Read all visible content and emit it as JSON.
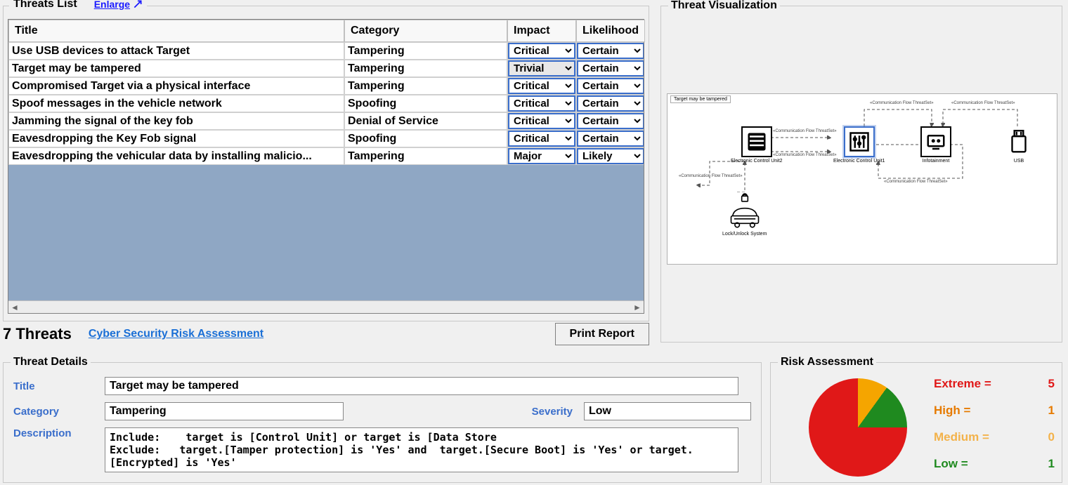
{
  "threats_list": {
    "label": "Threats List",
    "enlarge": "Enlarge",
    "columns": [
      "Title",
      "Category",
      "Impact",
      "Likelihood"
    ],
    "rows": [
      {
        "title": "Use USB devices to attack Target",
        "category": "Tampering",
        "impact": "Critical",
        "likelihood": "Certain"
      },
      {
        "title": "Target may be tampered",
        "category": "Tampering",
        "impact": "Trivial",
        "likelihood": "Certain",
        "impact_hl": true
      },
      {
        "title": "Compromised  Target via a physical interface",
        "category": "Tampering",
        "impact": "Critical",
        "likelihood": "Certain"
      },
      {
        "title": "Spoof messages in the vehicle network",
        "category": "Spoofing",
        "impact": "Critical",
        "likelihood": "Certain"
      },
      {
        "title": "Jamming the signal of the key fob",
        "category": "Denial of Service",
        "impact": "Critical",
        "likelihood": "Certain"
      },
      {
        "title": "Eavesdropping the Key Fob signal",
        "category": "Spoofing",
        "impact": "Critical",
        "likelihood": "Certain"
      },
      {
        "title": "Eavesdropping the vehicular data by installing malicio...",
        "category": "Tampering",
        "impact": "Major",
        "likelihood": "Likely"
      }
    ],
    "count_label": "7 Threats",
    "footer_link": "Cyber Security Risk Assessment",
    "print": "Print Report"
  },
  "viz": {
    "label": "Threat Visualization",
    "title": "Target may be tampered",
    "nodes": {
      "ecu2": "Electronic Control Unit2",
      "ecu1": "Electronic Control Unit1",
      "inft": "Infotainment",
      "usb": "USB",
      "lock": "Lock/Unlock System"
    },
    "flow": "«Communication Flow ThreatSet»"
  },
  "details": {
    "label": "Threat Details",
    "lbl_title": "Title",
    "lbl_category": "Category",
    "lbl_severity": "Severity",
    "lbl_description": "Description",
    "title": "Target may be tampered",
    "category": "Tampering",
    "severity": "Low",
    "description": "Include:    target is [Control Unit] or target is [Data Store\nExclude:   target.[Tamper protection] is 'Yes' and  target.[Secure Boot] is 'Yes' or target.[Encrypted] is 'Yes'"
  },
  "risk": {
    "label": "Risk Assessment",
    "legend": [
      {
        "name": "Extreme",
        "value": 5,
        "cls": "lg-extreme"
      },
      {
        "name": "High",
        "value": 1,
        "cls": "lg-high"
      },
      {
        "name": "Medium",
        "value": 0,
        "cls": "lg-medium"
      },
      {
        "name": "Low",
        "value": 1,
        "cls": "lg-low"
      }
    ]
  },
  "chart_data": {
    "type": "pie",
    "title": "Risk Assessment",
    "series": [
      {
        "name": "Extreme",
        "value": 5,
        "color": "#e01818"
      },
      {
        "name": "High",
        "value": 1,
        "color": "#e67a00"
      },
      {
        "name": "Medium",
        "value": 0,
        "color": "#f3b24a"
      },
      {
        "name": "Low",
        "value": 1,
        "color": "#1f8a1f"
      }
    ]
  }
}
